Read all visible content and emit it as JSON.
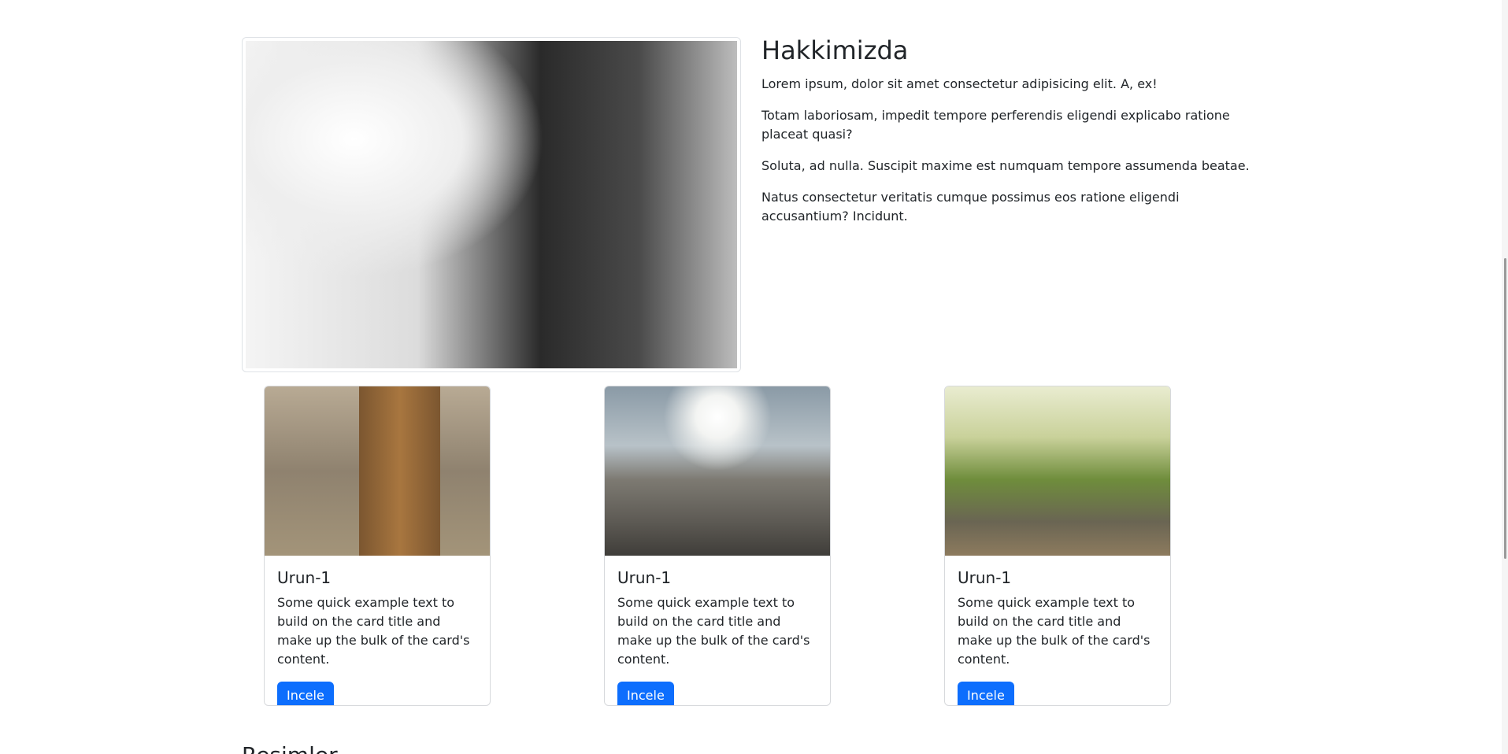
{
  "about": {
    "title": "Hakkimizda",
    "paragraphs": [
      "Lorem ipsum, dolor sit amet consectetur adipisicing elit. A, ex!",
      "Totam laboriosam, impedit tempore perferendis eligendi explicabo ratione placeat quasi?",
      "Soluta, ad nulla. Suscipit maxime est numquam tempore assumenda beatae.",
      "Natus consectetur veritatis cumque possimus eos ratione eligendi accusantium? Incidunt."
    ]
  },
  "cards": [
    {
      "title": "Urun-1",
      "text": "Some quick example text to build on the card title and make up the bulk of the card's content.",
      "button": "Incele"
    },
    {
      "title": "Urun-1",
      "text": "Some quick example text to build on the card title and make up the bulk of the card's content.",
      "button": "Incele"
    },
    {
      "title": "Urun-1",
      "text": "Some quick example text to build on the card title and make up the bulk of the card's content.",
      "button": "Incele"
    }
  ],
  "section": {
    "title": "Resimler"
  },
  "colors": {
    "primary_button": "#0d6efd"
  }
}
